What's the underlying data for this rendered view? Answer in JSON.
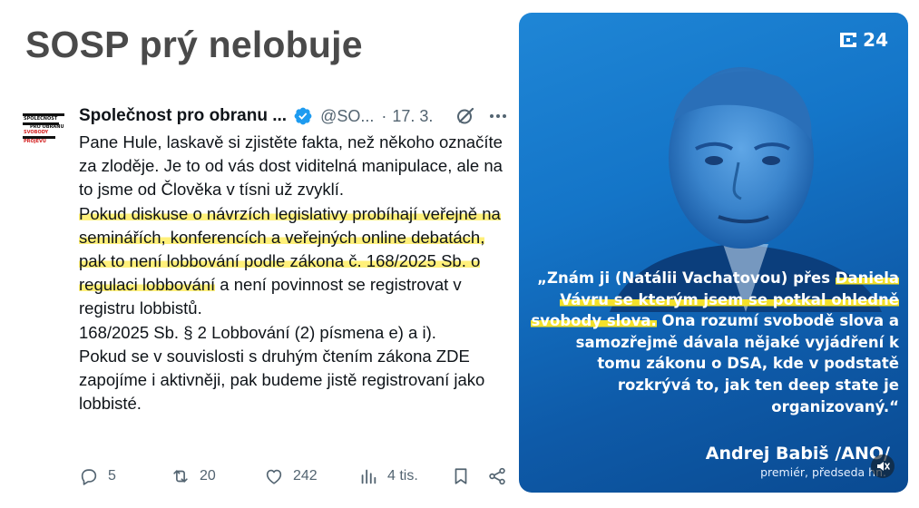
{
  "page": {
    "title": "SOSP prý nelobuje"
  },
  "tweet": {
    "avatar_lines": [
      "SPOLEČNOST",
      "PRO OBRANU",
      "SVOBODY",
      "PROJEVU"
    ],
    "author": "Společnost pro obranu ...",
    "handle": "@SO...",
    "separator": "·",
    "date": "17. 3.",
    "body": {
      "p1": "Pane Hule, laskavě si zjistěte fakta, než někoho označíte za zloděje. Je to od vás dost viditelná manipulace, ale na to jsme od Člověka v tísni už zvyklí.",
      "p2_highlight": "Pokud diskuse o návrzích legislativy probíhají veřejně na seminářích, konferencích a veřejných online debatách, pak to není lobbování podle zákona č. 168/2025 Sb. o regulaci lobbování",
      "p2_rest": " a není povinnost se registrovat v registru lobbistů.",
      "p3": "168/2025 Sb. § 2 Lobbování (2) písmena e) a  i).",
      "p4": "Pokud se v souvislosti s druhým čtením zákona ZDE zapojíme i aktivněji, pak budeme jistě registrovaní jako lobbisté."
    },
    "actions": {
      "replies": "5",
      "reposts": "20",
      "likes": "242",
      "views": "4 tis."
    },
    "icons": [
      "verified-badge-icon",
      "grok-icon",
      "more-icon",
      "reply-icon",
      "repost-icon",
      "like-icon",
      "views-icon",
      "bookmark-icon",
      "share-icon"
    ]
  },
  "image_card": {
    "logo": "24",
    "quote": {
      "part1": "„Znám ji (Natálii Vachatovou) přes ",
      "highlight": "Daniela Vávru se kterým jsem se potkal ohledně svobody slova.",
      "part2": " Ona rozumí svobodě slova a samozřejmě dávala nějaké vyjádření k tomu zákonu o DSA, kde v podstatě rozkrývá to, jak ten deep state je organizovaný.“"
    },
    "speaker": "Andrej Babiš  /ANO/",
    "role": "premiér, předseda hn.",
    "colors": {
      "background": "#1475c8",
      "highlight": "#f4e12a"
    }
  },
  "colors": {
    "highlight": "#fff07a",
    "verified": "#1d9bf0",
    "muted_text": "#536471"
  }
}
